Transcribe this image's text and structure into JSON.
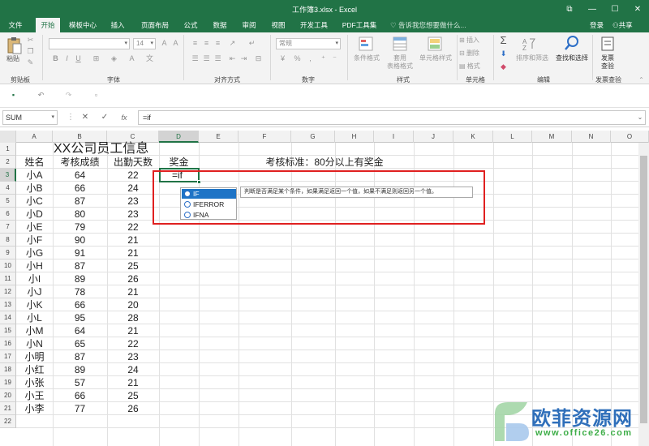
{
  "window": {
    "title": "工作簿3.xlsx - Excel",
    "buttons": [
      "restore-icon",
      "minimize-icon",
      "maximize-icon",
      "close-icon"
    ]
  },
  "menu": {
    "tabs": [
      "文件",
      "开始",
      "模板中心",
      "插入",
      "页面布局",
      "公式",
      "数据",
      "审阅",
      "视图",
      "开发工具",
      "PDF工具集"
    ],
    "active_tab": "开始",
    "tell_me": "告诉我您想要做什么...",
    "login": "登录",
    "share": "共享"
  },
  "ribbon": {
    "paste": "粘贴",
    "groups": [
      "剪贴板",
      "字体",
      "对齐方式",
      "数字",
      "样式",
      "单元格",
      "编辑",
      "发票查验"
    ],
    "font_size": "14",
    "number_format": "常规",
    "conditional_format": "条件格式",
    "table_format": "套用",
    "table_format2": "表格格式",
    "cell_style": "单元格样式",
    "insert": "插入",
    "delete": "删除",
    "format": "格式",
    "sort_filter": "排序和筛选",
    "find_select": "查找和选择",
    "invoice_check": "发票",
    "invoice_check2": "查验"
  },
  "formula_bar": {
    "name_box": "SUM",
    "formula": "=if",
    "cancel": "✕",
    "enter": "✓",
    "fx": "fx"
  },
  "sheet": {
    "columns": [
      "A",
      "B",
      "C",
      "D",
      "E",
      "F",
      "G",
      "H",
      "I",
      "J",
      "K",
      "L",
      "M",
      "N",
      "O"
    ],
    "rows": [
      "1",
      "2",
      "3",
      "4",
      "5",
      "6",
      "7",
      "8",
      "9",
      "10",
      "11",
      "12",
      "13",
      "14",
      "15",
      "16",
      "17",
      "18",
      "19",
      "20",
      "21",
      "22"
    ],
    "title": "XX公司员工信息",
    "headers": [
      "姓名",
      "考核成绩",
      "出勤天数",
      "奖金"
    ],
    "criteria": "考核标准：80分以上有奖金",
    "active_cell_text": "=if",
    "records": [
      [
        "小A",
        "64",
        "22"
      ],
      [
        "小B",
        "66",
        "24"
      ],
      [
        "小C",
        "87",
        "23"
      ],
      [
        "小D",
        "80",
        "23"
      ],
      [
        "小E",
        "79",
        "22"
      ],
      [
        "小F",
        "90",
        "21"
      ],
      [
        "小G",
        "91",
        "21"
      ],
      [
        "小H",
        "87",
        "25"
      ],
      [
        "小I",
        "89",
        "26"
      ],
      [
        "小J",
        "78",
        "21"
      ],
      [
        "小K",
        "66",
        "20"
      ],
      [
        "小L",
        "95",
        "28"
      ],
      [
        "小M",
        "64",
        "21"
      ],
      [
        "小N",
        "65",
        "22"
      ],
      [
        "小明",
        "87",
        "23"
      ],
      [
        "小红",
        "89",
        "24"
      ],
      [
        "小张",
        "57",
        "21"
      ],
      [
        "小王",
        "66",
        "25"
      ],
      [
        "小李",
        "77",
        "26"
      ]
    ]
  },
  "autocomplete": {
    "items": [
      "IF",
      "IFERROR",
      "IFNA"
    ],
    "highlighted": "IF",
    "tooltip": "判断是否满足某个条件，如果满足返回一个值，如果不满足则返回另一个值。"
  },
  "watermark": {
    "text": "欧菲资源网",
    "url": "www.office26.com"
  }
}
